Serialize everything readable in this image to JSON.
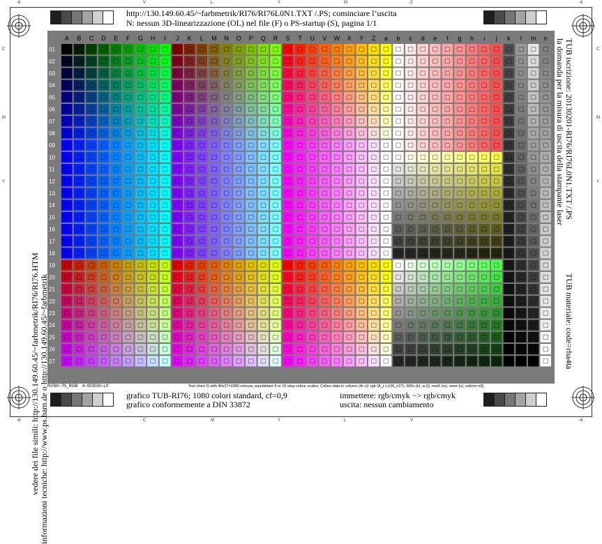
{
  "header": {
    "line1": "http://130.149.60.45/~farbmetrik/RI76/RI76L0N1.TXT /.PS; cominciare l’uscita",
    "line2": "N: nessun 3D-linearizzazione (OL) nel file (F) o PS-startup (S), pagina 1/1"
  },
  "left_margin": {
    "line1": "vedere dei file simili: http://130.149.60.45/~farbmetrik/RI76/RI76.HTM",
    "line2": "informazioni tecniche: http://www.ps.bam.de o http://130.149.60.45/~farbmetrik"
  },
  "right_margin": {
    "line1": "TUB iscrizione: 20130201-RI76/RI76L0N1.TXT /.PS",
    "line2": "la domanda per la misura di uscita della stampante laser",
    "material": "TUB materiale: code=rha4ta"
  },
  "footer": {
    "code_left": "RI760−7N_RGB",
    "code_mid": "4−003030−L0",
    "tech_note": "Test chart G with 40x27=1080 colours; equidistant 9 or 16 step colour scales; Colour data in column (A−n): rgb (A_j + k26_n27), 000n (k), w (l), nnn0 (m), www (n), colorm n0)",
    "line1": "grafico TUB-RI76; 1080 colori standard, cf=0,9",
    "line2": "grafico conformemente a DIN 33872",
    "input_label": "immettere: rgb/cmyk −> rgb/cmyk",
    "output_label": "uscita: nessun cambiamento"
  },
  "edge_marks": {
    "top": [
      "-6",
      "V",
      "L",
      "Y",
      "M",
      "C",
      "-6"
    ],
    "bottom": [
      "-6",
      "C",
      "M",
      "Y",
      "L",
      "V",
      "-6"
    ],
    "left": [
      "C",
      "M",
      "Y"
    ],
    "right": [
      "C",
      "M",
      "Y"
    ]
  },
  "chart_data": {
    "type": "heatmap",
    "columns": [
      "A",
      "B",
      "C",
      "D",
      "E",
      "F",
      "G",
      "H",
      "I",
      "J",
      "K",
      "L",
      "M",
      "N",
      "O",
      "P",
      "Q",
      "R",
      "S",
      "T",
      "U",
      "V",
      "W",
      "X",
      "Y",
      "Z",
      "a",
      "b",
      "c",
      "d",
      "e",
      "f",
      "g",
      "h",
      "i",
      "j",
      "k",
      "l",
      "m",
      "n"
    ],
    "rows": [
      "01",
      "02",
      "03",
      "04",
      "05",
      "06",
      "07",
      "08",
      "09",
      "10",
      "11",
      "12",
      "13",
      "14",
      "15",
      "16",
      "17",
      "18",
      "19",
      "20",
      "21",
      "22",
      "23",
      "24",
      "25",
      "26",
      "27"
    ],
    "total_colours": 1080
  },
  "colors": {
    "frame": "#333333",
    "chart_background": "#7a7a7a",
    "grey_strip": [
      "#1e1e1e",
      "#4a4a4a",
      "#767676",
      "#a3a3a3",
      "#d0d0d0",
      "#ffffff"
    ]
  }
}
